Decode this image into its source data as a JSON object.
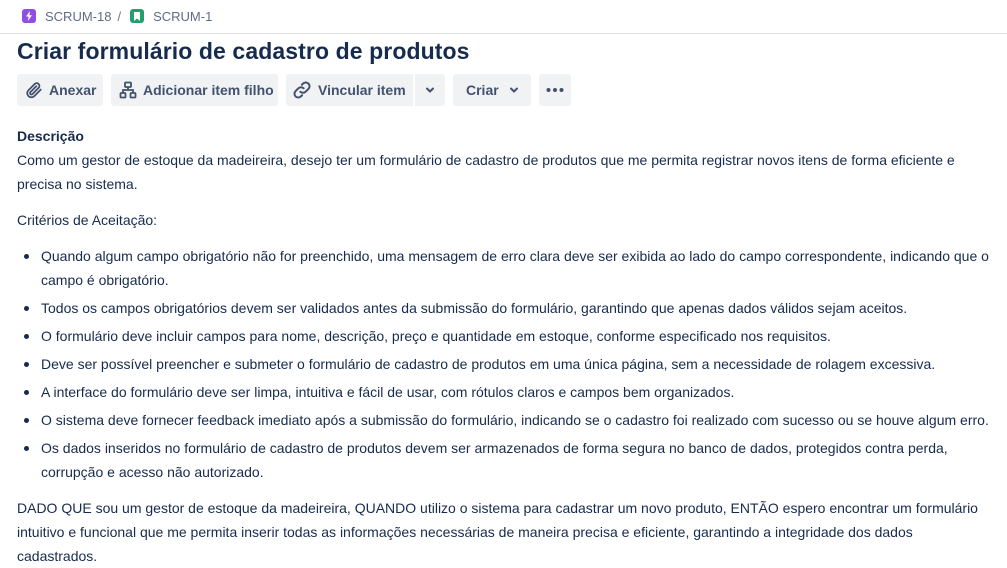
{
  "breadcrumb": {
    "items": [
      {
        "label": "SCRUM-18",
        "icon": "epic-icon",
        "color": "#904ee2"
      },
      {
        "label": "SCRUM-1",
        "icon": "story-icon",
        "color": "#22a06b"
      }
    ],
    "separator": "/"
  },
  "issue": {
    "title": "Criar formulário de cadastro de produtos"
  },
  "toolbar": {
    "attach_label": "Anexar",
    "add_child_label": "Adicionar item filho",
    "link_label": "Vincular item",
    "create_label": "Criar"
  },
  "description": {
    "label": "Descrição",
    "intro": "Como um gestor de estoque da madeireira, desejo ter um formulário de cadastro de produtos que me permita registrar novos itens de forma eficiente e precisa no sistema.",
    "criteria_heading": "Critérios de Aceitação:",
    "criteria": [
      "Quando algum campo obrigatório não for preenchido, uma mensagem de erro clara deve ser exibida ao lado do campo correspondente, indicando que o campo é obrigatório.",
      "Todos os campos obrigatórios devem ser validados antes da submissão do formulário, garantindo que apenas dados válidos sejam aceitos.",
      "O formulário deve incluir campos para nome, descrição, preço e quantidade em estoque, conforme especificado nos requisitos.",
      "Deve ser possível preencher e submeter o formulário de cadastro de produtos em uma única página, sem a necessidade de rolagem excessiva.",
      "A interface do formulário deve ser limpa, intuitiva e fácil de usar, com rótulos claros e campos bem organizados.",
      "O sistema deve fornecer feedback imediato após a submissão do formulário, indicando se o cadastro foi realizado com sucesso ou se houve algum erro.",
      "Os dados inseridos no formulário de cadastro de produtos devem ser armazenados de forma segura no banco de dados, protegidos contra perda, corrupção e acesso não autorizado."
    ],
    "given_when_then": "DADO QUE sou um gestor de estoque da madeireira, QUANDO utilizo o sistema para cadastrar um novo produto, ENTÃO espero encontrar um formulário intuitivo e funcional que me permita inserir todas as informações necessárias de maneira precisa e eficiente, garantindo a integridade dos dados cadastrados."
  }
}
